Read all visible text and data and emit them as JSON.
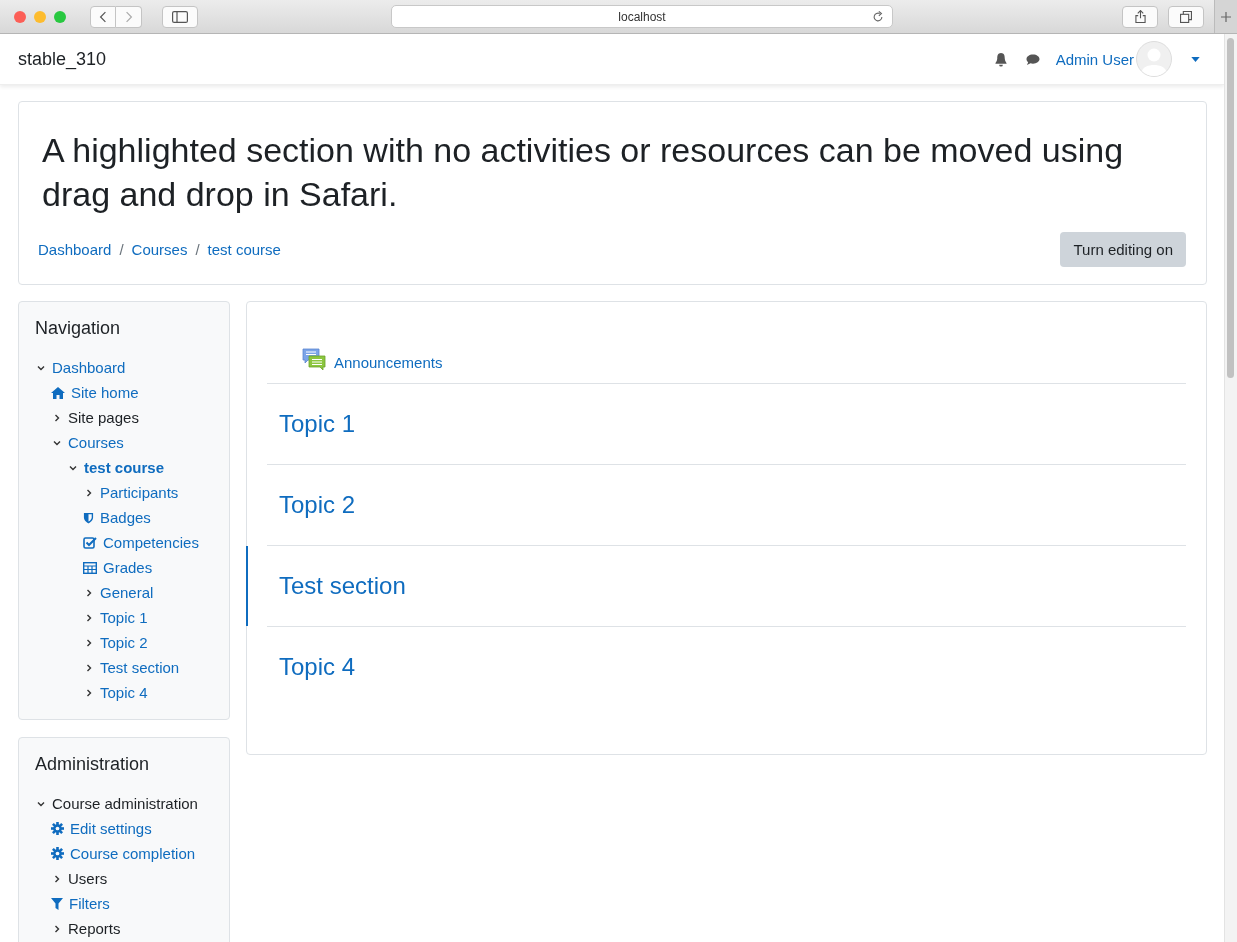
{
  "browser": {
    "address": "localhost"
  },
  "navbar": {
    "site_name": "stable_310",
    "user_name": "Admin User"
  },
  "header": {
    "title": "A highlighted section with no activities or resources can be moved using drag and drop in Safari.",
    "breadcrumbs": [
      "Dashboard",
      "Courses",
      "test course"
    ],
    "breadcrumb_separator": "/",
    "edit_button": "Turn editing on"
  },
  "navigation": {
    "title": "Navigation",
    "items": [
      {
        "label": "Dashboard",
        "kind": "expander",
        "expanded": true,
        "link": true,
        "current": false,
        "children": [
          {
            "label": "Site home",
            "kind": "home",
            "link": true,
            "current": false
          },
          {
            "label": "Site pages",
            "kind": "expander",
            "expanded": false,
            "link": false,
            "current": false
          },
          {
            "label": "Courses",
            "kind": "expander",
            "expanded": true,
            "link": true,
            "current": false,
            "children": [
              {
                "label": "test course",
                "kind": "expander",
                "expanded": true,
                "link": true,
                "current": true,
                "children": [
                  {
                    "label": "Participants",
                    "kind": "expander",
                    "expanded": false,
                    "link": true,
                    "current": false
                  },
                  {
                    "label": "Badges",
                    "kind": "shield",
                    "link": true,
                    "current": false
                  },
                  {
                    "label": "Competencies",
                    "kind": "checkbox",
                    "link": true,
                    "current": false
                  },
                  {
                    "label": "Grades",
                    "kind": "table",
                    "link": true,
                    "current": false
                  },
                  {
                    "label": "General",
                    "kind": "expander",
                    "expanded": false,
                    "link": true,
                    "current": false
                  },
                  {
                    "label": "Topic 1",
                    "kind": "expander",
                    "expanded": false,
                    "link": true,
                    "current": false
                  },
                  {
                    "label": "Topic 2",
                    "kind": "expander",
                    "expanded": false,
                    "link": true,
                    "current": false
                  },
                  {
                    "label": "Test section",
                    "kind": "expander",
                    "expanded": false,
                    "link": true,
                    "current": false
                  },
                  {
                    "label": "Topic 4",
                    "kind": "expander",
                    "expanded": false,
                    "link": true,
                    "current": false
                  }
                ]
              }
            ]
          }
        ]
      }
    ]
  },
  "administration": {
    "title": "Administration",
    "items": [
      {
        "label": "Course administration",
        "kind": "expander",
        "expanded": true,
        "link": false,
        "current": false,
        "children": [
          {
            "label": "Edit settings",
            "kind": "gear",
            "link": true,
            "current": false
          },
          {
            "label": "Course completion",
            "kind": "gear",
            "link": true,
            "current": false
          },
          {
            "label": "Users",
            "kind": "expander",
            "expanded": false,
            "link": false,
            "current": false
          },
          {
            "label": "Filters",
            "kind": "filter",
            "link": true,
            "current": false
          },
          {
            "label": "Reports",
            "kind": "expander",
            "expanded": false,
            "link": false,
            "current": false
          }
        ]
      }
    ]
  },
  "course": {
    "activity": "Announcements",
    "sections": [
      {
        "title": "Topic 1",
        "highlighted": false
      },
      {
        "title": "Topic 2",
        "highlighted": false
      },
      {
        "title": "Test section",
        "highlighted": true
      },
      {
        "title": "Topic 4",
        "highlighted": false
      }
    ]
  }
}
